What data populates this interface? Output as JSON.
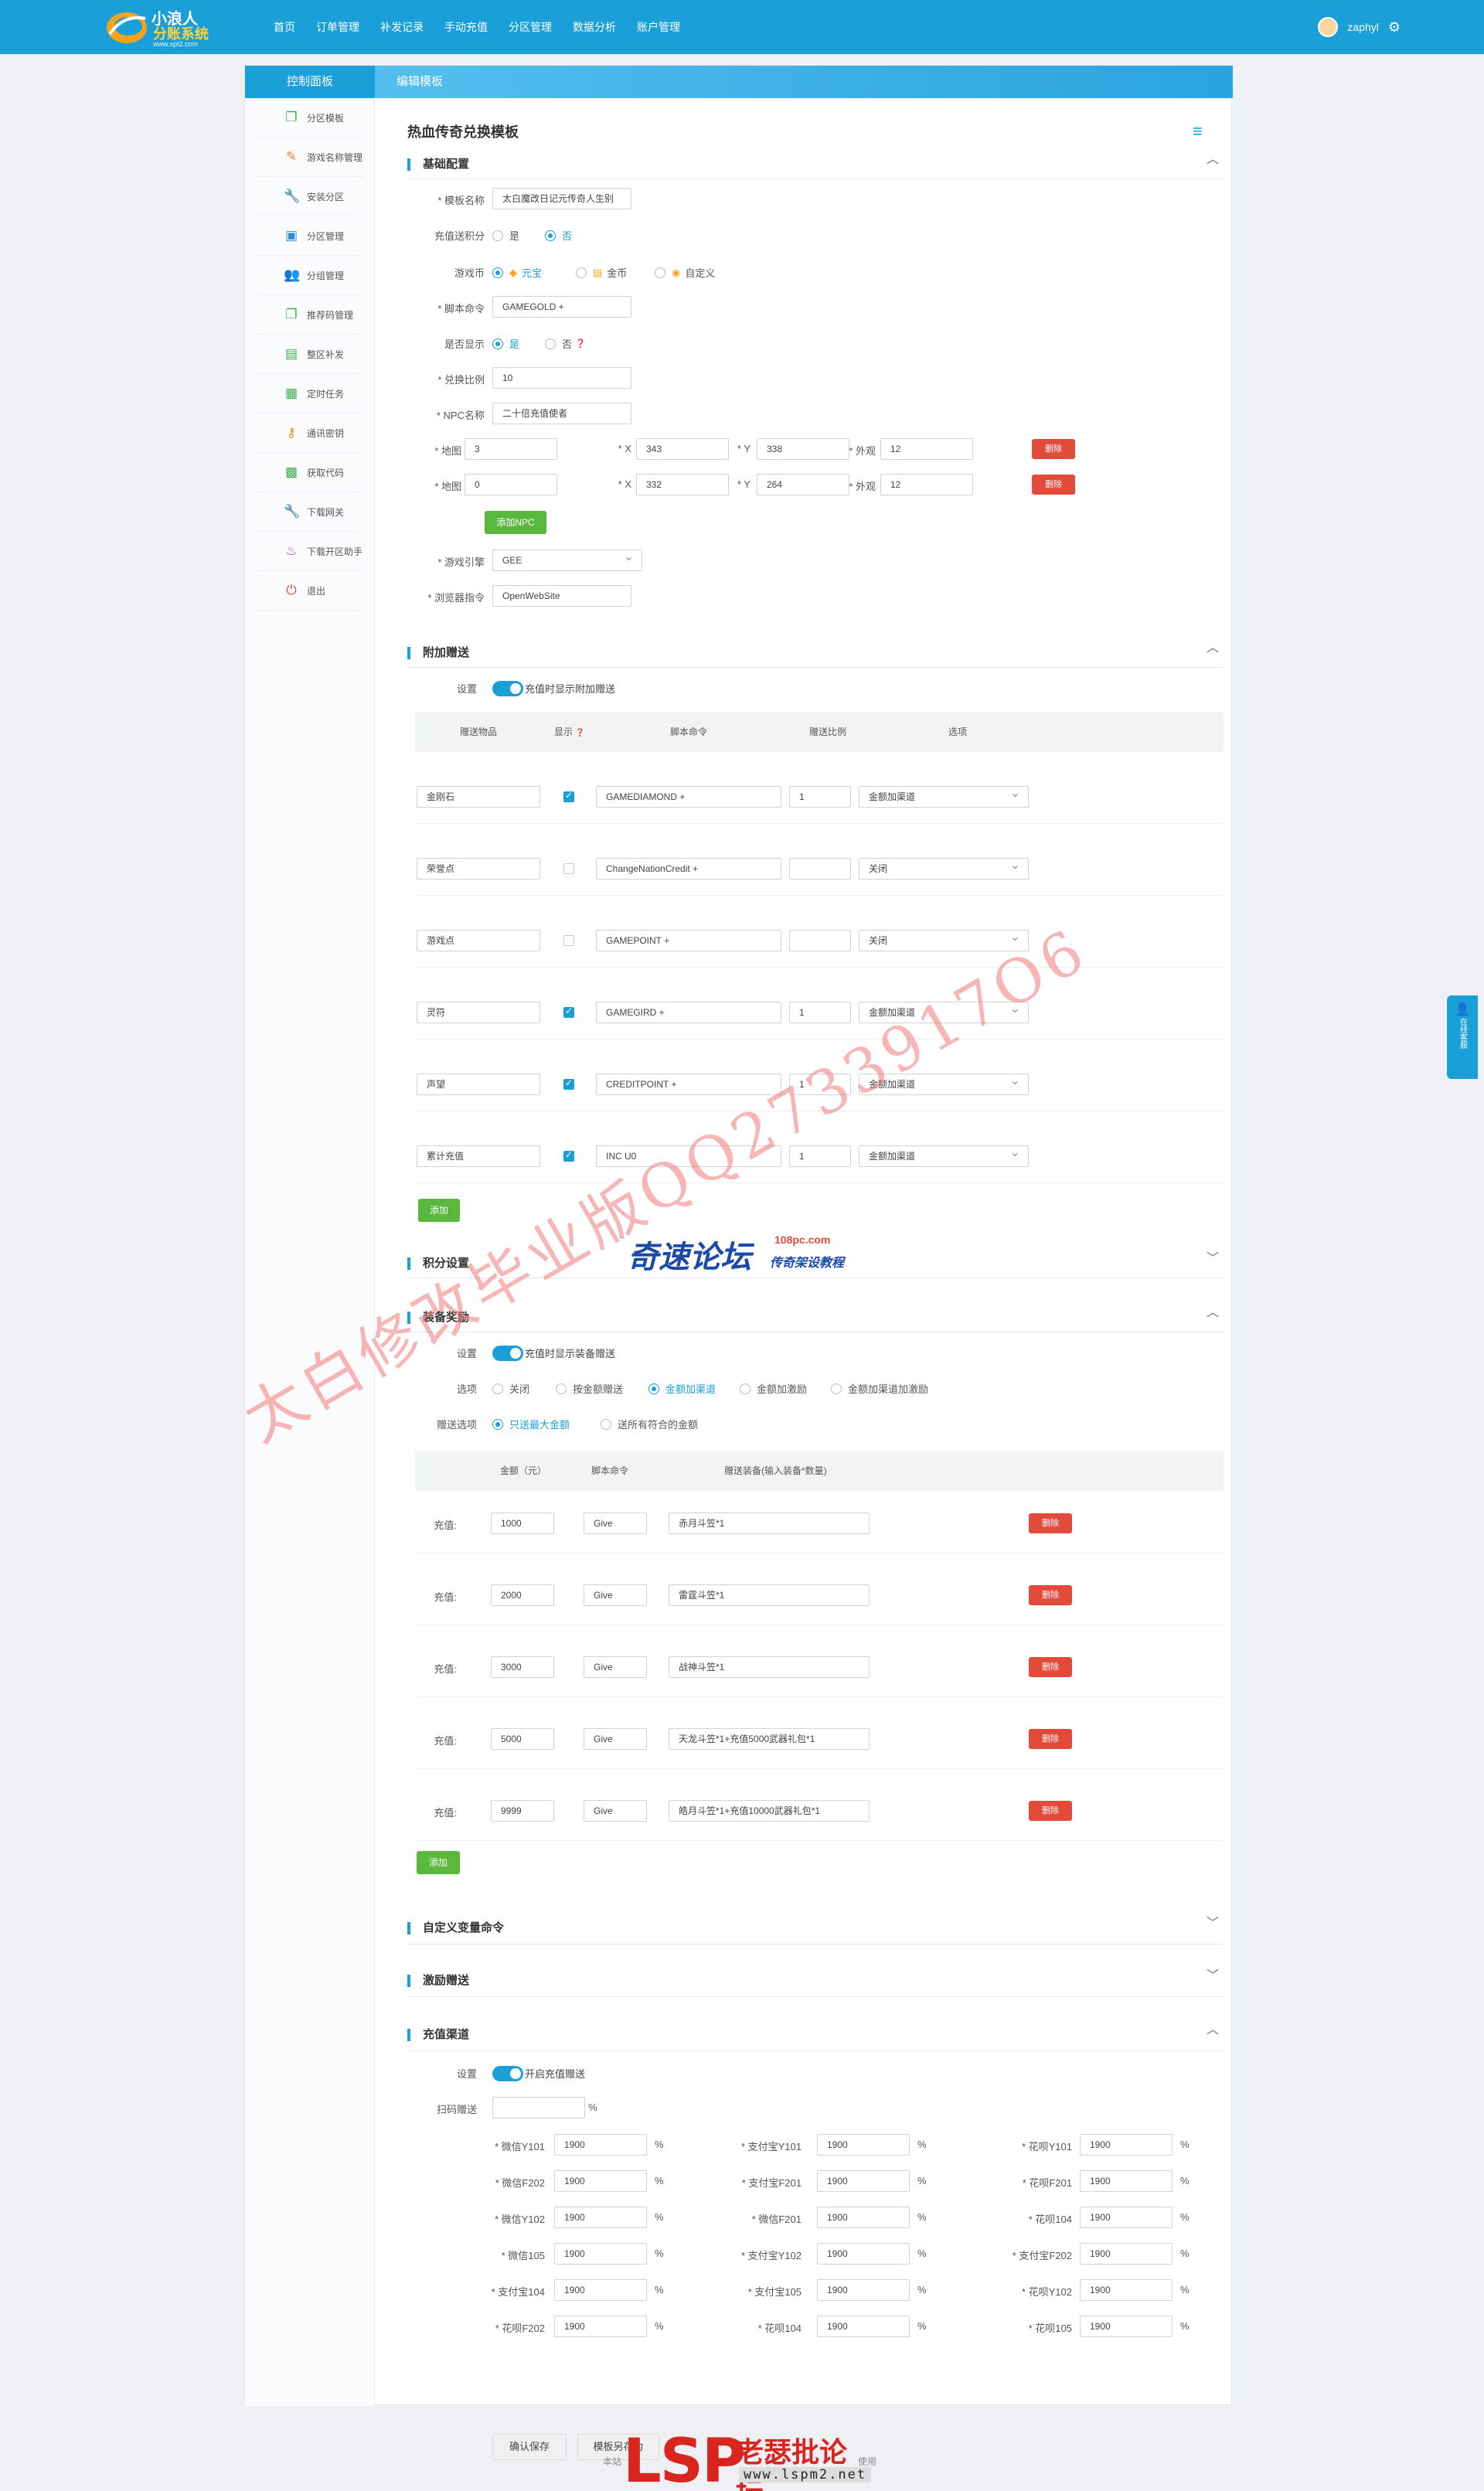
{
  "header": {
    "logo": {
      "line1": "小浪人",
      "line2": "分账系统",
      "url_text": "www.xpt2.com"
    },
    "nav": [
      "首页",
      "订单管理",
      "补发记录",
      "手动充值",
      "分区管理",
      "数据分析",
      "账户管理"
    ],
    "username": "zaphyl",
    "settings_icon": "gear-icon"
  },
  "sidebar": {
    "title": "控制面板",
    "items": [
      {
        "label": "分区模板",
        "icon": "copy-icon"
      },
      {
        "label": "游戏名称管理",
        "icon": "pencil-icon"
      },
      {
        "label": "安装分区",
        "icon": "wrench-icon"
      },
      {
        "label": "分区管理",
        "icon": "inbox-icon"
      },
      {
        "label": "分组管理",
        "icon": "users-icon"
      },
      {
        "label": "推荐码管理",
        "icon": "copy-icon"
      },
      {
        "label": "整区补发",
        "icon": "box-icon"
      },
      {
        "label": "定时任务",
        "icon": "calendar-icon"
      },
      {
        "label": "通讯密钥",
        "icon": "key-icon"
      },
      {
        "label": "获取代码",
        "icon": "briefcase-icon"
      },
      {
        "label": "下载网关",
        "icon": "wrench-icon"
      },
      {
        "label": "下载开区助手",
        "icon": "cake-icon"
      },
      {
        "label": "退出",
        "icon": "power-icon"
      }
    ]
  },
  "breadcrumb": "编辑模板",
  "page_title": "热血传奇兑换模板",
  "basic": {
    "title": "基础配置",
    "template_name_label": "模板名称",
    "template_name": "太白魔改日记元传奇人生别",
    "points_label": "充值送积分",
    "yes": "是",
    "no": "否",
    "currency_label": "游戏币",
    "currency_opts": [
      "元宝",
      "金币",
      "自定义"
    ],
    "script_label": "脚本命令",
    "script_value": "GAMEGOLD +",
    "show_label": "是否显示",
    "ratio_label": "兑换比例",
    "ratio_value": "10",
    "npc_label": "NPC名称",
    "npc_value": "二十倍充值使者",
    "map_label": "地图",
    "x_label": "X",
    "y_label": "Y",
    "look_label": "外观",
    "npcs": [
      {
        "map": "3",
        "x": "343",
        "y": "338",
        "look": "12"
      },
      {
        "map": "0",
        "x": "332",
        "y": "264",
        "look": "12"
      }
    ],
    "delete": "删除",
    "add_npc": "添加NPC",
    "engine_label": "游戏引擎",
    "engine_value": "GEE",
    "browser_label": "浏览器指令",
    "browser_value": "OpenWebSite"
  },
  "extra": {
    "title": "附加赠送",
    "setting_label": "设置",
    "switch_text": "充值时显示附加赠送",
    "headers": [
      "赠送物品",
      "显示",
      "脚本命令",
      "赠送比例",
      "选项"
    ],
    "rows": [
      {
        "item": "金刚石",
        "checked": true,
        "cmd": "GAMEDIAMOND +",
        "ratio": "1",
        "option": "金额加渠道"
      },
      {
        "item": "荣誉点",
        "checked": false,
        "cmd": "ChangeNationCredit +",
        "ratio": "",
        "option": "关闭"
      },
      {
        "item": "游戏点",
        "checked": false,
        "cmd": "GAMEPOINT +",
        "ratio": "",
        "option": "关闭"
      },
      {
        "item": "灵符",
        "checked": true,
        "cmd": "GAMEGIRD +",
        "ratio": "1",
        "option": "金额加渠道"
      },
      {
        "item": "声望",
        "checked": true,
        "cmd": "CREDITPOINT +",
        "ratio": "1",
        "option": "金额加渠道"
      },
      {
        "item": "累计充值",
        "checked": true,
        "cmd": "INC U0",
        "ratio": "1",
        "option": "金额加渠道"
      }
    ],
    "add": "添加"
  },
  "points_section": {
    "title": "积分设置"
  },
  "equip": {
    "title": "装备奖励",
    "setting_label": "设置",
    "switch_text": "充值时显示装备赠送",
    "option_label": "选项",
    "options": [
      "关闭",
      "按金额赠送",
      "金额加渠道",
      "金额加激励",
      "金额加渠道加激励"
    ],
    "gift_label": "赠送选项",
    "gift_opts": [
      "只送最大金额",
      "送所有符合的金额"
    ],
    "headers": [
      "金额（元）",
      "脚本命令",
      "赠送装备(输入装备*数量)"
    ],
    "row_label": "充值:",
    "rows": [
      {
        "amount": "1000",
        "cmd": "Give",
        "gift": "赤月斗笠*1"
      },
      {
        "amount": "2000",
        "cmd": "Give",
        "gift": "雷霆斗笠*1"
      },
      {
        "amount": "3000",
        "cmd": "Give",
        "gift": "战神斗笠*1"
      },
      {
        "amount": "5000",
        "cmd": "Give",
        "gift": "天龙斗笠*1+充值5000武器礼包*1"
      },
      {
        "amount": "9999",
        "cmd": "Give",
        "gift": "皓月斗笠*1+充值10000武器礼包*1"
      }
    ],
    "delete": "删除",
    "add": "添加"
  },
  "custom_var": {
    "title": "自定义变量命令"
  },
  "incentive": {
    "title": "激励赠送"
  },
  "channel": {
    "title": "充值渠道",
    "setting_label": "设置",
    "switch_text": "开启充值赠送",
    "scan_label": "扫码赠送",
    "scan_unit": "%",
    "grid": [
      {
        "label": "微信Y101",
        "value": "1900"
      },
      {
        "label": "支付宝Y101",
        "value": "1900"
      },
      {
        "label": "花呗Y101",
        "value": "1900"
      },
      {
        "label": "微信F202",
        "value": "1900"
      },
      {
        "label": "支付宝F201",
        "value": "1900"
      },
      {
        "label": "花呗F201",
        "value": "1900"
      },
      {
        "label": "微信Y102",
        "value": "1900"
      },
      {
        "label": "微信F201",
        "value": "1900"
      },
      {
        "label": "花呗104",
        "value": "1900"
      },
      {
        "label": "微信105",
        "value": "1900"
      },
      {
        "label": "支付宝Y102",
        "value": "1900"
      },
      {
        "label": "支付宝F202",
        "value": "1900"
      },
      {
        "label": "支付宝104",
        "value": "1900"
      },
      {
        "label": "支付宝105",
        "value": "1900"
      },
      {
        "label": "花呗Y102",
        "value": "1900"
      },
      {
        "label": "花呗F202",
        "value": "1900"
      },
      {
        "label": "花呗104",
        "value": "1900"
      },
      {
        "label": "花呗105",
        "value": "1900"
      }
    ],
    "unit": "%",
    "save": "确认保存",
    "save_as": "模板另存为"
  },
  "footer": {
    "left": "本站",
    "right": "使用"
  },
  "watermarks": {
    "diag": "太白修改毕业版QQ2733917O6",
    "forum_main": "奇速论坛",
    "forum_url": "108pc.com",
    "forum_sub": "传奇架设教程",
    "lsp_big": "LSP",
    "lsp_cn": "老瑟批论坛",
    "lsp_url": "www.lspm2.net"
  },
  "side_widget": "在线客服"
}
